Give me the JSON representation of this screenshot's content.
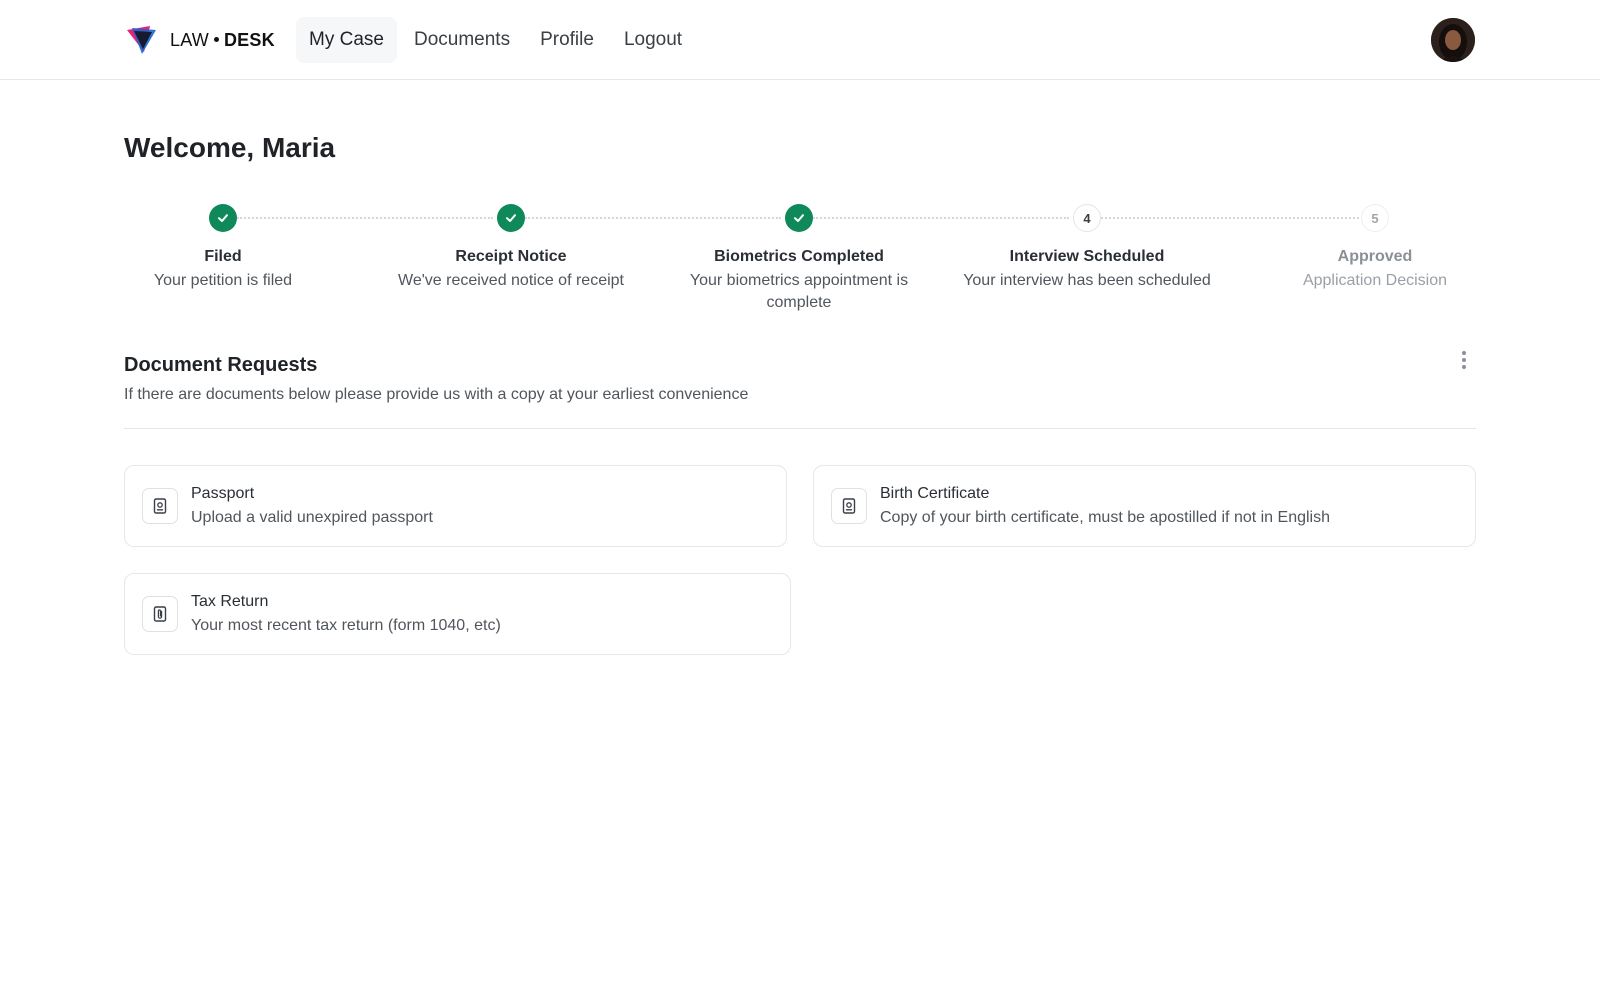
{
  "header": {
    "brand": {
      "word1": "LAW",
      "word2": "DESK"
    },
    "nav": [
      {
        "label": "My Case",
        "active": true
      },
      {
        "label": "Documents",
        "active": false
      },
      {
        "label": "Profile",
        "active": false
      },
      {
        "label": "Logout",
        "active": false
      }
    ]
  },
  "main": {
    "welcome": "Welcome, Maria",
    "steps": [
      {
        "number": "1",
        "title": "Filed",
        "description": "Your petition is filed",
        "status": "done"
      },
      {
        "number": "2",
        "title": "Receipt Notice",
        "description": "We've received notice of receipt",
        "status": "done"
      },
      {
        "number": "3",
        "title": "Biometrics Completed",
        "description": "Your biometrics appointment is complete",
        "status": "done"
      },
      {
        "number": "4",
        "title": "Interview Scheduled",
        "description": "Your interview has been scheduled",
        "status": "current"
      },
      {
        "number": "5",
        "title": "Approved",
        "description": "Application Decision",
        "status": "upcoming"
      }
    ],
    "document_requests": {
      "title": "Document Requests",
      "description": "If there are documents below please provide us with a copy at your earliest convenience",
      "items": [
        {
          "title": "Passport",
          "description": "Upload a valid unexpired passport",
          "icon": "passport-icon"
        },
        {
          "title": "Birth Certificate",
          "description": "Copy of your birth certificate, must be apostilled if not in English",
          "icon": "passport-icon"
        },
        {
          "title": "Tax Return",
          "description": "Your most recent tax return (form 1040, etc)",
          "icon": "paperclip-document-icon"
        }
      ]
    }
  },
  "colors": {
    "accent_done": "#10895a",
    "border": "#e5e7eb",
    "text_primary": "#1f2328",
    "text_secondary": "#50565c"
  }
}
